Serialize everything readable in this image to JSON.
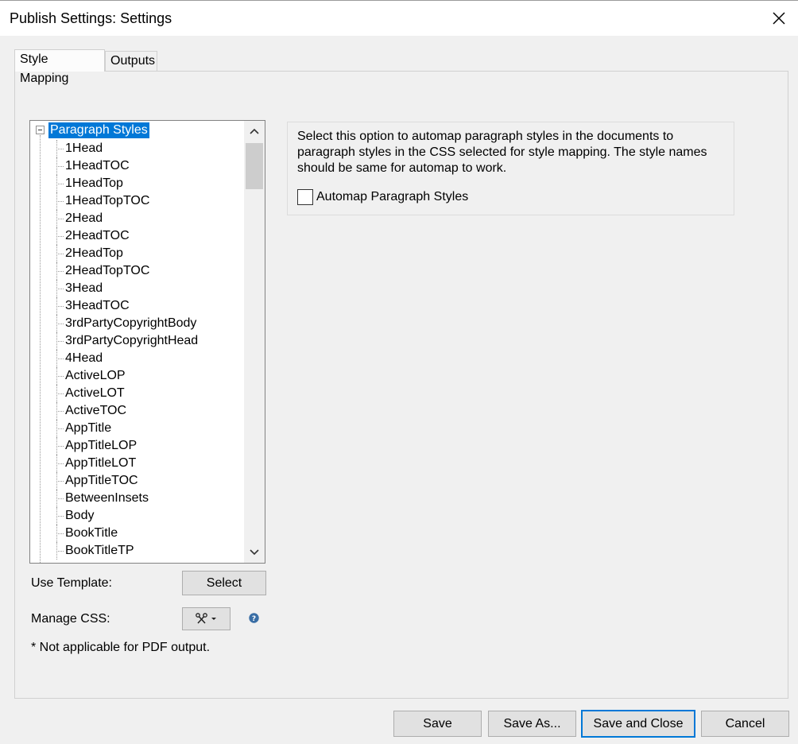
{
  "window": {
    "title": "Publish Settings: Settings"
  },
  "tabs": [
    {
      "label": "Style Mapping",
      "active": true
    },
    {
      "label": "Outputs",
      "active": false
    }
  ],
  "tree": {
    "root_label": "Paragraph Styles",
    "items": [
      "1Head",
      "1HeadTOC",
      "1HeadTop",
      "1HeadTopTOC",
      "2Head",
      "2HeadTOC",
      "2HeadTop",
      "2HeadTopTOC",
      "3Head",
      "3HeadTOC",
      "3rdPartyCopyrightBody",
      "3rdPartyCopyrightHead",
      "4Head",
      "ActiveLOP",
      "ActiveLOT",
      "ActiveTOC",
      "AppTitle",
      "AppTitleLOP",
      "AppTitleLOT",
      "AppTitleTOC",
      "BetweenInsets",
      "Body",
      "BookTitle",
      "BookTitleTP"
    ]
  },
  "left": {
    "use_template_label": "Use Template:",
    "select_button": "Select",
    "manage_css_label": "Manage CSS:",
    "note": "* Not applicable for PDF output."
  },
  "automap": {
    "description": "Select this option to automap paragraph styles in the documents to paragraph styles in the CSS selected for style mapping. The style names should be same for automap to work.",
    "checkbox_label": "Automap Paragraph Styles",
    "checked": false
  },
  "footer": {
    "save": "Save",
    "save_as": "Save As...",
    "save_and_close": "Save and Close",
    "cancel": "Cancel"
  },
  "colors": {
    "selection": "#0078d7",
    "help_icon": "#3a6ea5"
  }
}
